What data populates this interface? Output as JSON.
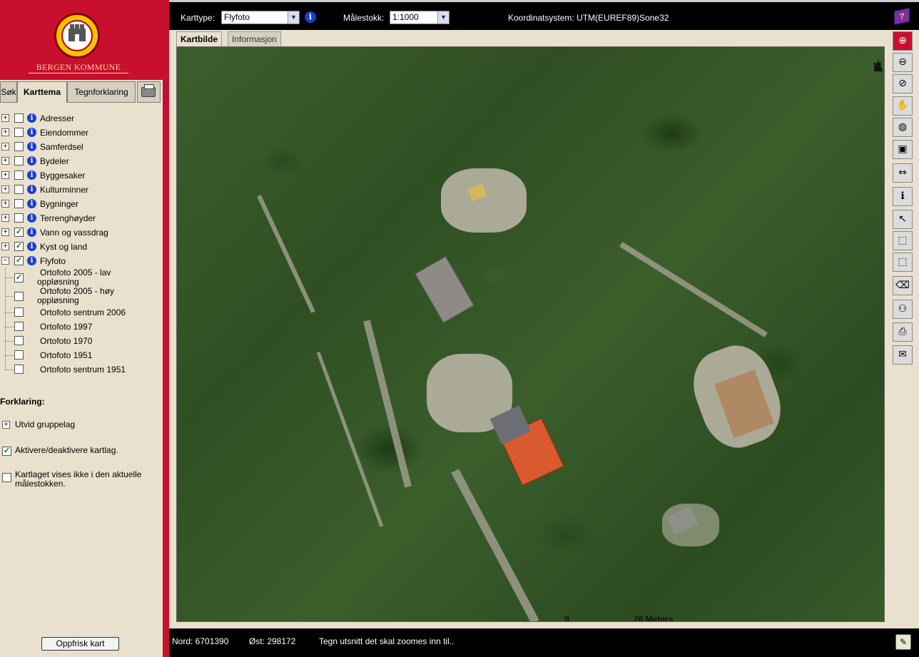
{
  "brand": {
    "name": "BERGEN KOMMUNE"
  },
  "left_tabs": [
    {
      "label": "Søk"
    },
    {
      "label": "Karttema"
    },
    {
      "label": "Tegnforklaring"
    }
  ],
  "layers": [
    {
      "label": "Adresser",
      "checked": false,
      "expand": "+"
    },
    {
      "label": "Eiendommer",
      "checked": false,
      "expand": "+"
    },
    {
      "label": "Samferdsel",
      "checked": false,
      "expand": "+"
    },
    {
      "label": "Bydeler",
      "checked": false,
      "expand": "+"
    },
    {
      "label": "Byggesaker",
      "checked": false,
      "expand": "+"
    },
    {
      "label": "Kulturminner",
      "checked": false,
      "expand": "+"
    },
    {
      "label": "Bygninger",
      "checked": false,
      "expand": "+"
    },
    {
      "label": "Terrenghøyder",
      "checked": false,
      "expand": "+"
    },
    {
      "label": "Vann og vassdrag",
      "checked": true,
      "expand": "+"
    },
    {
      "label": "Kyst og land",
      "checked": true,
      "expand": "+"
    },
    {
      "label": "Flyfoto",
      "checked": true,
      "expand": "−"
    }
  ],
  "sublayers": [
    {
      "label1": "Ortofoto 2005 - lav",
      "label2": "oppløsning",
      "checked": true
    },
    {
      "label1": "Ortofoto 2005 - høy",
      "label2": "oppløsning",
      "checked": false
    },
    {
      "label1": "Ortofoto sentrum 2006",
      "label2": "",
      "checked": false
    },
    {
      "label1": "Ortofoto 1997",
      "label2": "",
      "checked": false
    },
    {
      "label1": "Ortofoto 1970",
      "label2": "",
      "checked": false
    },
    {
      "label1": "Ortofoto 1951",
      "label2": "",
      "checked": false
    },
    {
      "label1": "Ortofoto sentrum 1951",
      "label2": "",
      "checked": false
    }
  ],
  "legend": {
    "title": "Forklaring:",
    "expand_text": "Utvid gruppelag",
    "toggle_text": "Aktivere/deaktivere kartlag.",
    "hidden_text": "Kartlaget vises ikke i den aktuelle målestokken."
  },
  "refresh_label": "Oppfrisk kart",
  "topbar": {
    "maptype_label": "Karttype:",
    "maptype_value": "Flyfoto",
    "scale_label": "Målestokk:",
    "scale_value": "1:1000",
    "coord_label": "Koordinatsystem: UTM(EUREF89)Sone32"
  },
  "map_tabs": [
    {
      "label": "Kartbilde"
    },
    {
      "label": "Informasjon"
    }
  ],
  "map": {
    "north_label": "N",
    "scale_zero": "0",
    "scale_text": "26 Meters"
  },
  "tools": [
    {
      "icon": "zoom-in-icon",
      "glyph": "⊕"
    },
    {
      "icon": "zoom-out-icon",
      "glyph": "⊖"
    },
    {
      "icon": "zoom-previous-icon",
      "glyph": "⊘"
    },
    {
      "icon": "pan-hand-icon",
      "glyph": "✋"
    },
    {
      "icon": "globe-icon",
      "glyph": "◍"
    },
    {
      "icon": "full-extent-icon",
      "glyph": "▣"
    },
    {
      "icon": "measure-icon",
      "glyph": "⇔"
    },
    {
      "icon": "info-icon",
      "glyph": "ℹ"
    },
    {
      "icon": "select-line-icon",
      "glyph": "↖"
    },
    {
      "icon": "select-rect-icon",
      "glyph": "⬚"
    },
    {
      "icon": "select-poly-icon",
      "glyph": "⬚"
    },
    {
      "icon": "eraser-icon",
      "glyph": "⌫"
    },
    {
      "icon": "binoculars-icon",
      "glyph": "⚇"
    },
    {
      "icon": "print-icon",
      "glyph": "⎙"
    },
    {
      "icon": "mail-icon",
      "glyph": "✉"
    }
  ],
  "status": {
    "nord": "Nord: 6701390",
    "ost": "Øst: 298172",
    "message": "Tegn utsnitt det skal zoomes inn til.."
  }
}
